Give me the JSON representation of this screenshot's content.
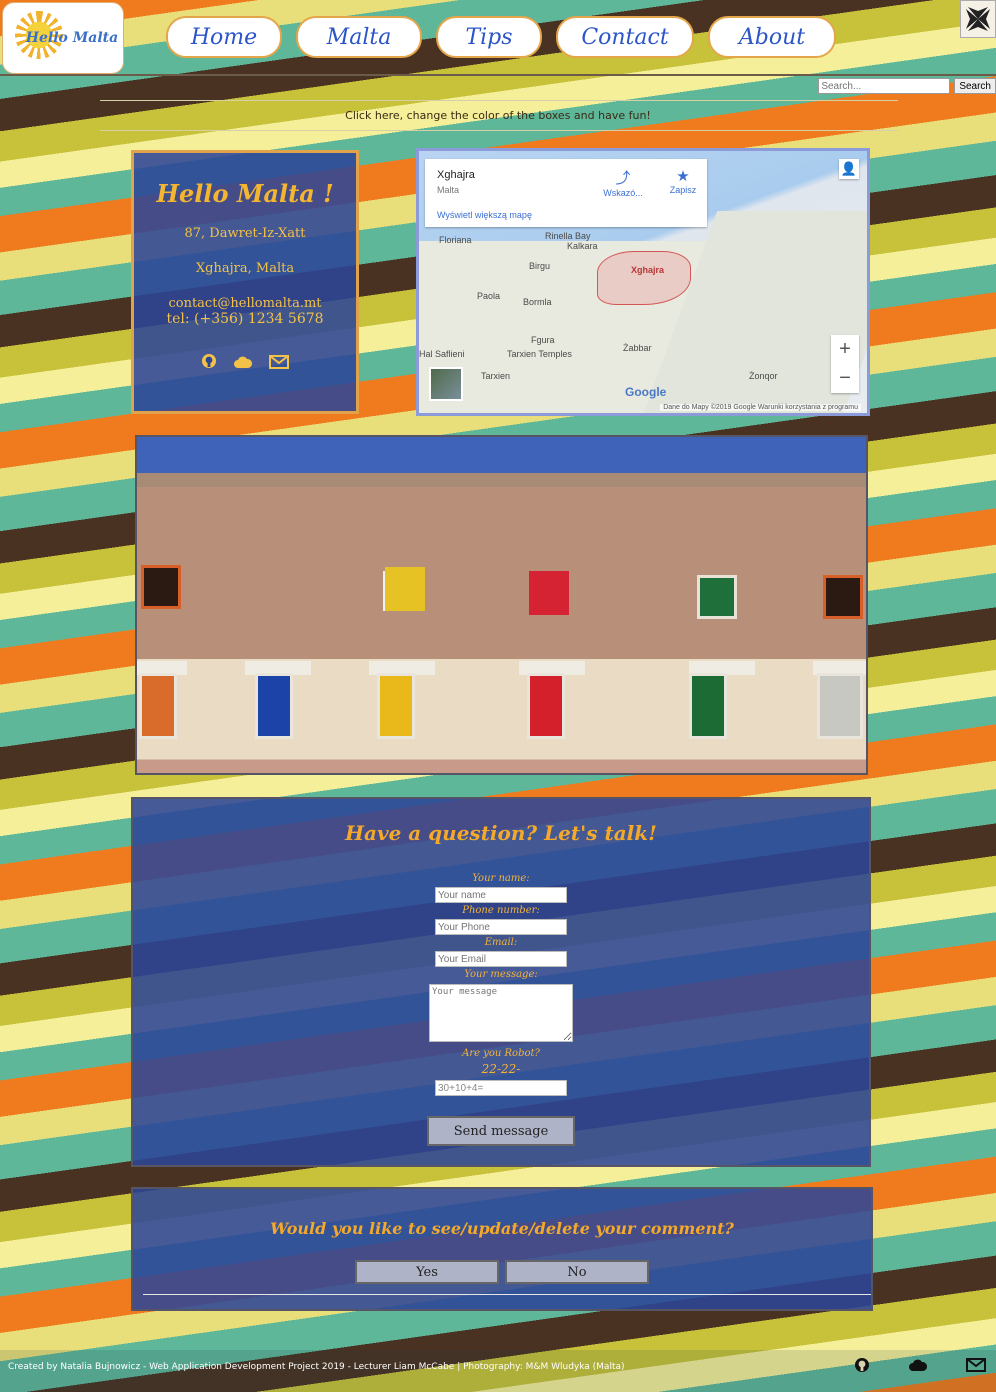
{
  "header": {
    "logo_text": "Hello Malta",
    "nav": [
      {
        "label": "Home"
      },
      {
        "label": "Malta"
      },
      {
        "label": "Tips"
      },
      {
        "label": "Contact"
      },
      {
        "label": "About"
      }
    ],
    "search_placeholder": "Search...",
    "search_button": "Search"
  },
  "hint": "Click here, change the color of the boxes and have fun!",
  "contact_card": {
    "title": "Hello Malta !",
    "street": "87, Dawret-Iz-Xatt",
    "city": "Xghajra, Malta",
    "email": "contact@hellomalta.mt",
    "phone": "tel: (+356) 1234 5678",
    "icons": [
      "github-icon",
      "cloud-icon",
      "mail-icon"
    ]
  },
  "map": {
    "place": "Xghajra",
    "country": "Malta",
    "larger_map": "Wyświetl większą mapę",
    "directions": "Wskazó...",
    "save": "Zapisz",
    "labels": {
      "floriana": "Floriana",
      "rinella": "Rinella Bay",
      "kalkara": "Kalkara",
      "birgu": "Birgu",
      "xghajra": "Xghajra",
      "paola": "Paola",
      "bormla": "Bormla",
      "fgura": "Fgura",
      "zabbar": "Żabbar",
      "safflieni": "Hal Saflieni",
      "tarxien_temples": "Tarxien Temples",
      "tarxien": "Tarxien",
      "zonqor": "Żonqor"
    },
    "zoom_in": "+",
    "zoom_out": "−",
    "google": "Google",
    "attribution": "Dane do Mapy ©2019 Google   Warunki korzystania z programu"
  },
  "form": {
    "title": "Have a question? Let's talk!",
    "name_label": "Your name:",
    "name_placeholder": "Your name",
    "phone_label": "Phone number:",
    "phone_placeholder": "Your Phone",
    "email_label": "Email:",
    "email_placeholder": "Your Email",
    "message_label": "Your message:",
    "message_placeholder": "Your message",
    "robot_label": "Are you Robot?",
    "captcha_text": "22-22-",
    "robot_value": "30+10+4=",
    "send_label": "Send message"
  },
  "comment_panel": {
    "title": "Would you like to see/update/delete your comment?",
    "yes": "Yes",
    "no": "No"
  },
  "footer": {
    "credits": "Created by Natalia Bujnowicz - Web Application Development Project 2019 - Lecturer Liam McCabe | Photography: M&M Wludyka (Malta)",
    "icons": [
      "github-icon",
      "cloud-icon",
      "mail-icon"
    ]
  },
  "colors": {
    "panel_blue": "#2c4696",
    "accent_orange": "#f4a92a",
    "nav_text": "#2c55c9"
  }
}
